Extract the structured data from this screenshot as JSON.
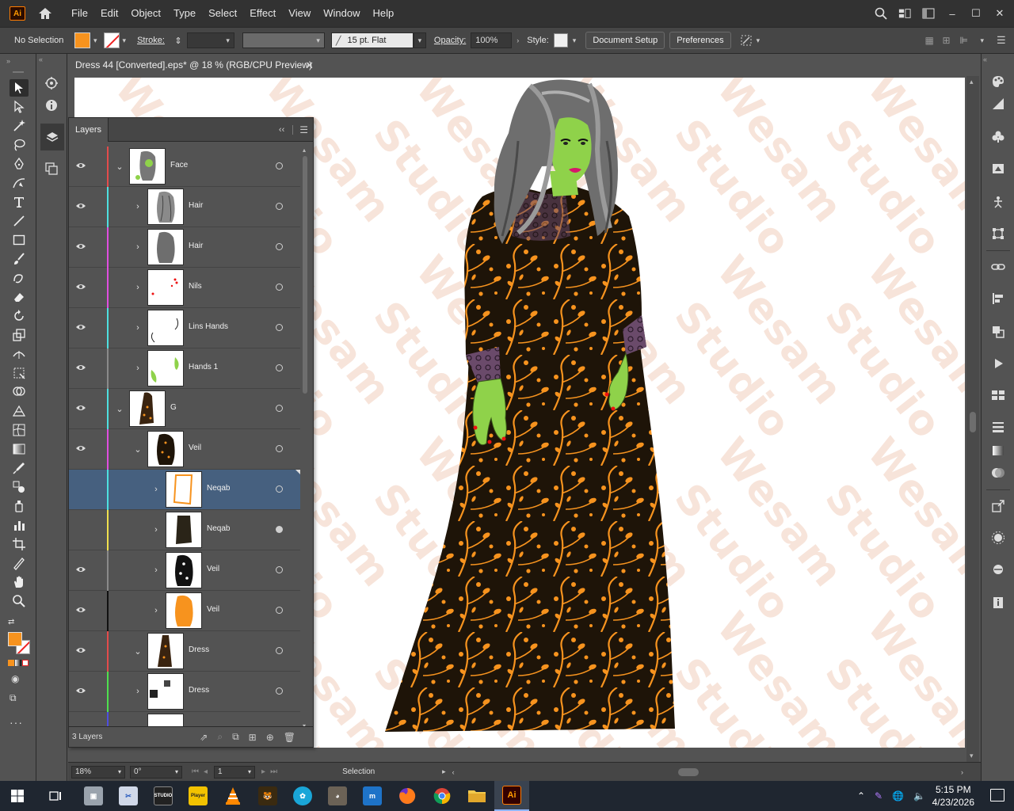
{
  "menubar": {
    "items": [
      "File",
      "Edit",
      "Object",
      "Type",
      "Select",
      "Effect",
      "View",
      "Window",
      "Help"
    ]
  },
  "control": {
    "selection": "No Selection",
    "stroke_label": "Stroke:",
    "brush": "15 pt. Flat",
    "opacity_label": "Opacity:",
    "opacity": "100%",
    "style_label": "Style:",
    "document_setup": "Document Setup",
    "preferences": "Preferences"
  },
  "document": {
    "tab_title": "Dress 44 [Converted].eps* @ 18 % (RGB/CPU Preview)",
    "watermark_a": "Wesam",
    "watermark_b": "Studio"
  },
  "layers_panel": {
    "title": "Layers",
    "footer": "3 Layers",
    "rows": [
      {
        "name": "Face",
        "color": "#e34b4b",
        "depth": 0,
        "expanded": true,
        "visible": true,
        "target": "hollow"
      },
      {
        "name": "Hair",
        "color": "#4ee0e0",
        "depth": 1,
        "expanded": false,
        "visible": true,
        "target": "hollow"
      },
      {
        "name": "Hair",
        "color": "#e04ee0",
        "depth": 1,
        "expanded": false,
        "visible": true,
        "target": "hollow"
      },
      {
        "name": "Nils",
        "color": "#e04ee0",
        "depth": 1,
        "expanded": false,
        "visible": true,
        "target": "hollow"
      },
      {
        "name": "Lins Hands",
        "color": "#4ee0e0",
        "depth": 1,
        "expanded": false,
        "visible": true,
        "target": "hollow"
      },
      {
        "name": "Hands 1",
        "color": "#8a8a8a",
        "depth": 1,
        "expanded": false,
        "visible": true,
        "target": "hollow"
      },
      {
        "name": "G",
        "color": "#4ee0e0",
        "depth": 0,
        "expanded": true,
        "visible": true,
        "target": "hollow"
      },
      {
        "name": "Veil",
        "color": "#e04ee0",
        "depth": 1,
        "expanded": true,
        "visible": true,
        "target": "hollow"
      },
      {
        "name": "Neqab",
        "color": "#4ee0e0",
        "depth": 2,
        "expanded": false,
        "visible": false,
        "target": "hollow",
        "selected": true
      },
      {
        "name": "Neqab",
        "color": "#f0e04e",
        "depth": 2,
        "expanded": false,
        "visible": false,
        "target": "filled"
      },
      {
        "name": "Veil",
        "color": "#8a8a8a",
        "depth": 2,
        "expanded": false,
        "visible": true,
        "target": "hollow"
      },
      {
        "name": "Veil",
        "color": "#111111",
        "depth": 2,
        "expanded": false,
        "visible": true,
        "target": "hollow"
      },
      {
        "name": "Dress",
        "color": "#e34b4b",
        "depth": 1,
        "expanded": true,
        "visible": true,
        "target": "hollow"
      },
      {
        "name": "Dress",
        "color": "#4ee04e",
        "depth": 1,
        "expanded": false,
        "visible": true,
        "target": "hollow"
      },
      {
        "name": "",
        "color": "#4e4ee0",
        "depth": 1,
        "expanded": false,
        "visible": true,
        "target": "hollow"
      }
    ]
  },
  "statusbar": {
    "zoom": "18%",
    "rotate": "0°",
    "artboard": "1",
    "tool": "Selection"
  },
  "taskbar": {
    "time": "5:15 PM",
    "date": "4/23/2026",
    "ai_label": "Ai",
    "studio_label": "STUDIO",
    "player_label": "Player"
  },
  "colors": {
    "fill": "#f7931e",
    "accent": "#46607f",
    "dress": "#1e1408",
    "pattern": "#f7931e",
    "skin": "#8fd24a"
  }
}
